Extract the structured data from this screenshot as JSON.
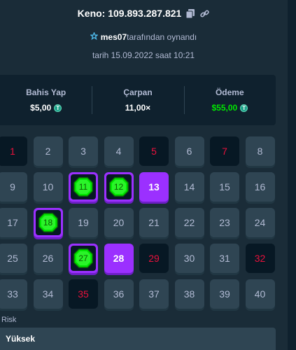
{
  "header": {
    "title": "Keno: 109.893.287.821",
    "player": "mes07",
    "played_by_suffix": "tarafından oynandı",
    "date": "tarih 15.09.2022 saat 10:21"
  },
  "stats": {
    "bet_label": "Bahis Yap",
    "bet_value": "$5,00",
    "multiplier_label": "Çarpan",
    "multiplier_value": "11,00×",
    "payout_label": "Ödeme",
    "payout_value": "$55,00",
    "coin_symbol": "T"
  },
  "tiles": [
    {
      "n": "1",
      "state": "dark"
    },
    {
      "n": "2",
      "state": "normal"
    },
    {
      "n": "3",
      "state": "normal"
    },
    {
      "n": "4",
      "state": "normal"
    },
    {
      "n": "5",
      "state": "dark"
    },
    {
      "n": "6",
      "state": "normal"
    },
    {
      "n": "7",
      "state": "dark"
    },
    {
      "n": "8",
      "state": "normal"
    },
    {
      "n": "9",
      "state": "normal"
    },
    {
      "n": "10",
      "state": "normal"
    },
    {
      "n": "11",
      "state": "hit"
    },
    {
      "n": "12",
      "state": "hit"
    },
    {
      "n": "13",
      "state": "selected"
    },
    {
      "n": "14",
      "state": "normal"
    },
    {
      "n": "15",
      "state": "normal"
    },
    {
      "n": "16",
      "state": "normal"
    },
    {
      "n": "17",
      "state": "normal"
    },
    {
      "n": "18",
      "state": "hit"
    },
    {
      "n": "19",
      "state": "normal"
    },
    {
      "n": "20",
      "state": "normal"
    },
    {
      "n": "21",
      "state": "normal"
    },
    {
      "n": "22",
      "state": "normal"
    },
    {
      "n": "23",
      "state": "normal"
    },
    {
      "n": "24",
      "state": "normal"
    },
    {
      "n": "25",
      "state": "normal"
    },
    {
      "n": "26",
      "state": "normal"
    },
    {
      "n": "27",
      "state": "hit"
    },
    {
      "n": "28",
      "state": "selected"
    },
    {
      "n": "29",
      "state": "dark"
    },
    {
      "n": "30",
      "state": "normal"
    },
    {
      "n": "31",
      "state": "normal"
    },
    {
      "n": "32",
      "state": "dark"
    },
    {
      "n": "33",
      "state": "normal"
    },
    {
      "n": "34",
      "state": "normal"
    },
    {
      "n": "35",
      "state": "dark"
    },
    {
      "n": "36",
      "state": "normal"
    },
    {
      "n": "37",
      "state": "normal"
    },
    {
      "n": "38",
      "state": "normal"
    },
    {
      "n": "39",
      "state": "normal"
    },
    {
      "n": "40",
      "state": "normal"
    }
  ],
  "risk": {
    "label": "Risk",
    "value": "Yüksek"
  },
  "colors": {
    "background": "#1a2c38",
    "panel": "#0f212e",
    "tile": "#2f4553",
    "selected": "#9b30ff",
    "gem": "#00e701",
    "miss_text": "#e9113c"
  }
}
